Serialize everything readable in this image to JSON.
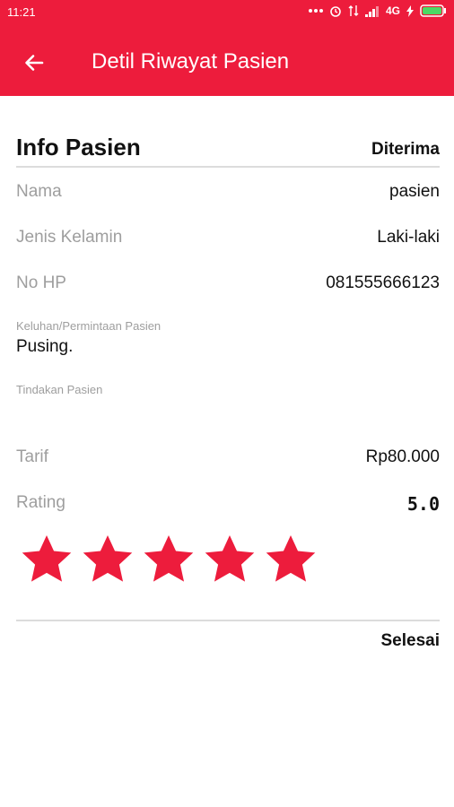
{
  "status_bar": {
    "time": "11:21",
    "network": "4G"
  },
  "toolbar": {
    "title": "Detil Riwayat Pasien"
  },
  "info": {
    "section_title": "Info Pasien",
    "status": "Diterima",
    "fields": [
      {
        "label": "Nama",
        "value": "pasien"
      },
      {
        "label": "Jenis Kelamin",
        "value": "Laki-laki"
      },
      {
        "label": "No HP",
        "value": "081555666123"
      }
    ],
    "complaint_label": "Keluhan/Permintaan Pasien",
    "complaint_value": "Pusing.",
    "action_label": "Tindakan Pasien",
    "action_value": ""
  },
  "billing": {
    "tarif_label": "Tarif",
    "tarif_value": "Rp80.000",
    "rating_label": "Rating",
    "rating_value": "5.0",
    "stars_filled": 5,
    "stars_total": 5
  },
  "footer": {
    "status": "Selesai"
  },
  "colors": {
    "accent": "#ed1c3c",
    "label_gray": "#9e9e9e",
    "divider": "#dcdcdc"
  },
  "icons": [
    "back-arrow-icon",
    "star-icon"
  ]
}
